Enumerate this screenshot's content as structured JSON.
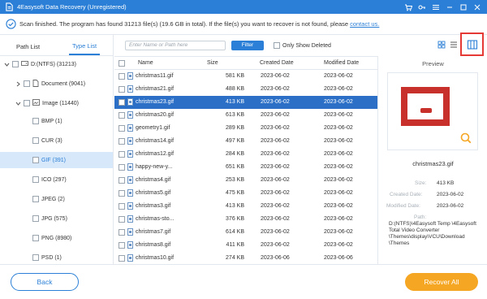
{
  "window": {
    "title": "4Easysoft Data Recovery (Unregistered)",
    "accent_color": "#2b7fd6"
  },
  "info": {
    "message": "Scan finished. The program has found 31213 file(s) (19.6 GB in total). If the file(s) you want to recover is not found, please",
    "link": "contact us."
  },
  "left_tabs": {
    "path_list": "Path List",
    "type_list": "Type List"
  },
  "tree": [
    {
      "label": "D:(NTFS) (31213)",
      "level": 0,
      "expanded": true,
      "icon": "drive-icon"
    },
    {
      "label": "Document (9041)",
      "level": 1,
      "expanded": false,
      "icon": "document-icon"
    },
    {
      "label": "Image (11440)",
      "level": 1,
      "expanded": true,
      "icon": "image-icon"
    },
    {
      "label": "BMP (1)",
      "level": 2
    },
    {
      "label": "CUR (3)",
      "level": 2
    },
    {
      "label": "GIF (391)",
      "level": 2,
      "selected": true
    },
    {
      "label": "ICO (297)",
      "level": 2
    },
    {
      "label": "JPEG (2)",
      "level": 2
    },
    {
      "label": "JPG (575)",
      "level": 2
    },
    {
      "label": "PNG (8980)",
      "level": 2
    },
    {
      "label": "PSD (1)",
      "level": 2
    }
  ],
  "toolbar": {
    "search_placeholder": "Enter Name or Path here",
    "filter_label": "Filter",
    "only_deleted_label": "Only Show Deleted"
  },
  "columns": {
    "name": "Name",
    "size": "Size",
    "created": "Created Date",
    "modified": "Modified Date"
  },
  "files": [
    {
      "name": "christmas11.gif",
      "size": "581 KB",
      "created": "2023-06-02",
      "modified": "2023-06-02"
    },
    {
      "name": "christmas21.gif",
      "size": "488 KB",
      "created": "2023-06-02",
      "modified": "2023-06-02"
    },
    {
      "name": "christmas23.gif",
      "size": "413 KB",
      "created": "2023-06-02",
      "modified": "2023-06-02",
      "selected": true
    },
    {
      "name": "christmas20.gif",
      "size": "613 KB",
      "created": "2023-06-02",
      "modified": "2023-06-02"
    },
    {
      "name": "geometry1.gif",
      "size": "289 KB",
      "created": "2023-06-02",
      "modified": "2023-06-02"
    },
    {
      "name": "christmas14.gif",
      "size": "497 KB",
      "created": "2023-06-02",
      "modified": "2023-06-02"
    },
    {
      "name": "christmas12.gif",
      "size": "284 KB",
      "created": "2023-06-02",
      "modified": "2023-06-02"
    },
    {
      "name": "happy-new-y...",
      "size": "651 KB",
      "created": "2023-06-02",
      "modified": "2023-06-02"
    },
    {
      "name": "christmas4.gif",
      "size": "253 KB",
      "created": "2023-06-02",
      "modified": "2023-06-02"
    },
    {
      "name": "christmas5.gif",
      "size": "475 KB",
      "created": "2023-06-02",
      "modified": "2023-06-02"
    },
    {
      "name": "christmas3.gif",
      "size": "413 KB",
      "created": "2023-06-02",
      "modified": "2023-06-02"
    },
    {
      "name": "christmas-sto...",
      "size": "376 KB",
      "created": "2023-06-02",
      "modified": "2023-06-02"
    },
    {
      "name": "christmas7.gif",
      "size": "614 KB",
      "created": "2023-06-02",
      "modified": "2023-06-02"
    },
    {
      "name": "christmas8.gif",
      "size": "411 KB",
      "created": "2023-06-02",
      "modified": "2023-06-02"
    },
    {
      "name": "christmas10.gif",
      "size": "274 KB",
      "created": "2023-06-06",
      "modified": "2023-06-06"
    }
  ],
  "preview": {
    "header": "Preview",
    "file_name": "christmas23.gif",
    "size_label": "Size:",
    "size_value": "413 KB",
    "created_label": "Created Date:",
    "created_value": "2023-06-02",
    "modified_label": "Modified Date:",
    "modified_value": "2023-06-02",
    "path_label": "Path:",
    "path_value": "D:(NTFS)\\4Easysoft Temp \\4Easysoft Total Video Converter \\Themes\\display\\VCU\\Download \\Themes"
  },
  "bottom": {
    "back_label": "Back",
    "recover_label": "Recover All"
  }
}
